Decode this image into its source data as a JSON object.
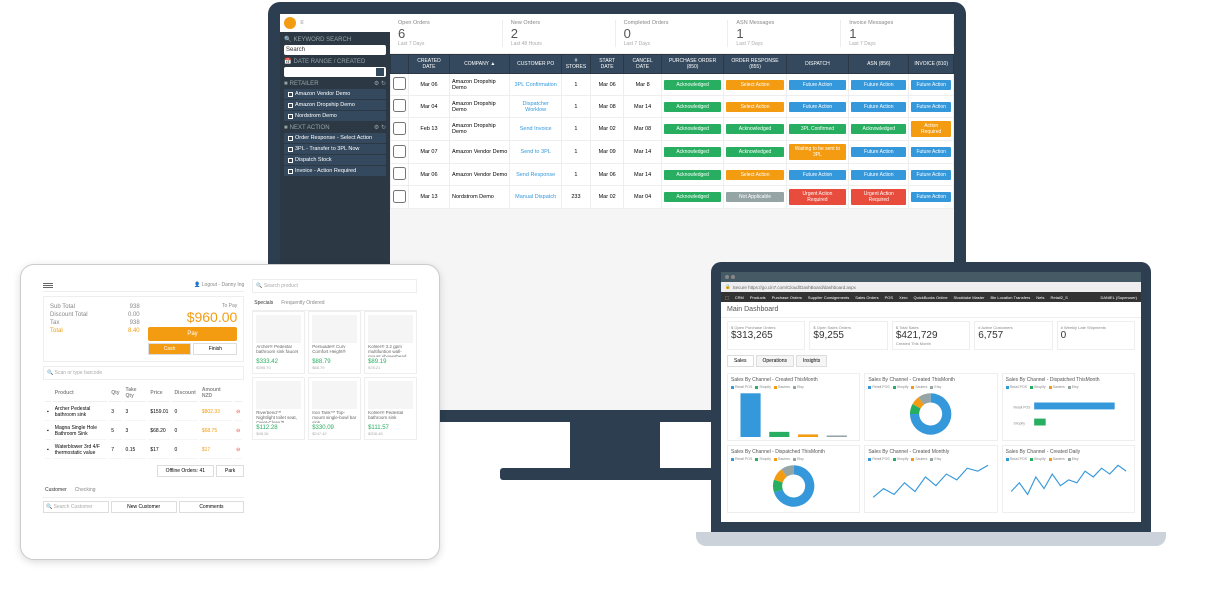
{
  "monitor": {
    "sidebar": {
      "keyword_search_label": "KEYWORD SEARCH",
      "search_placeholder": "Search",
      "date_range_label": "DATE RANGE / CREATED",
      "retailer_label": "RETAILER",
      "retailers": [
        "Amazon Vendor Demo",
        "Amazon Dropship Demo",
        "Nordstrom Demo"
      ],
      "next_action_label": "NEXT ACTION",
      "next_actions": [
        "Order Response - Select Action",
        "3PL - Transfer to 3PL Now",
        "Dispatch Stock",
        "Invoice - Action Required"
      ]
    },
    "stats": [
      {
        "label": "Open Orders",
        "value": "6",
        "sub": "Last 7 Days"
      },
      {
        "label": "New Orders",
        "value": "2",
        "sub": "Last 48 Hours"
      },
      {
        "label": "Completed Orders",
        "value": "0",
        "sub": "Last 7 Days"
      },
      {
        "label": "ASN Messages",
        "value": "1",
        "sub": "Last 7 Days"
      },
      {
        "label": "Invoice Messages",
        "value": "1",
        "sub": "Last 7 Days"
      }
    ],
    "table": {
      "headers": [
        "",
        "CREATED DATE",
        "COMPANY ▲",
        "CUSTOMER PO",
        "# STORES",
        "START DATE",
        "CANCEL DATE",
        "PURCHASE ORDER (850)",
        "ORDER RESPONSE (855)",
        "DISPATCH",
        "ASN (856)",
        "INVOICE (810)"
      ],
      "rows": [
        {
          "date": "Mar 06",
          "company": "Amazon Dropship Demo",
          "po": "3PL Confirmation",
          "stores": "1",
          "start": "Mar 06",
          "cancel": "Mar 8",
          "cells": [
            {
              "t": "Acknowledged",
              "c": "green"
            },
            {
              "t": "Select Action",
              "c": "orange"
            },
            {
              "t": "Future Action",
              "c": "blue"
            },
            {
              "t": "Future Action",
              "c": "blue"
            },
            {
              "t": "Future Action",
              "c": "blue"
            }
          ]
        },
        {
          "date": "Mar 04",
          "company": "Amazon Dropship Demo",
          "po": "Dispatcher Worklow",
          "stores": "1",
          "start": "Mar 08",
          "cancel": "Mar 14",
          "cells": [
            {
              "t": "Acknowledged",
              "c": "green"
            },
            {
              "t": "Select Action",
              "c": "orange"
            },
            {
              "t": "Future Action",
              "c": "blue"
            },
            {
              "t": "Future Action",
              "c": "blue"
            },
            {
              "t": "Future Action",
              "c": "blue"
            }
          ]
        },
        {
          "date": "Feb 13",
          "company": "Amazon Dropship Demo",
          "po": "Send Invoice",
          "stores": "1",
          "start": "Mar 02",
          "cancel": "Mar 08",
          "cells": [
            {
              "t": "Acknowledged",
              "c": "green"
            },
            {
              "t": "Acknowledged",
              "c": "green"
            },
            {
              "t": "3PL Confirmed",
              "c": "green"
            },
            {
              "t": "Acknowledged",
              "c": "green"
            },
            {
              "t": "Action Required",
              "c": "orange"
            }
          ]
        },
        {
          "date": "Mar 07",
          "company": "Amazon Vendor Demo",
          "po": "Send to 3PL",
          "stores": "1",
          "start": "Mar 09",
          "cancel": "Mar 14",
          "cells": [
            {
              "t": "Acknowledged",
              "c": "green"
            },
            {
              "t": "Acknowledged",
              "c": "green"
            },
            {
              "t": "Waiting to be sent to 3PL",
              "c": "orange"
            },
            {
              "t": "Future Action",
              "c": "blue"
            },
            {
              "t": "Future Action",
              "c": "blue"
            }
          ]
        },
        {
          "date": "Mar 06",
          "company": "Amazon Vendor Demo",
          "po": "Send Response",
          "stores": "1",
          "start": "Mar 06",
          "cancel": "Mar 14",
          "cells": [
            {
              "t": "Acknowledged",
              "c": "green"
            },
            {
              "t": "Select Action",
              "c": "orange"
            },
            {
              "t": "Future Action",
              "c": "blue"
            },
            {
              "t": "Future Action",
              "c": "blue"
            },
            {
              "t": "Future Action",
              "c": "blue"
            }
          ]
        },
        {
          "date": "Mar 13",
          "company": "Nordstrom Demo",
          "po": "Manual Dispatch",
          "stores": "233",
          "start": "Mar 02",
          "cancel": "Mar 04",
          "cells": [
            {
              "t": "Acknowledged",
              "c": "green"
            },
            {
              "t": "Not Applicable",
              "c": "gray"
            },
            {
              "t": "Urgent Action Required",
              "c": "red"
            },
            {
              "t": "Urgent Action Required",
              "c": "red"
            },
            {
              "t": "Future Action",
              "c": "blue"
            }
          ]
        }
      ]
    }
  },
  "tablet": {
    "user_label": "Logout - Danny Ing",
    "totals": {
      "subtotal_label": "Sub Total",
      "subtotal": "938",
      "discount_label": "Discount Total",
      "discount": "0.00",
      "tax_label": "Tax",
      "tax": "938",
      "total_label": "Total",
      "total": "8.40",
      "topay_label": "To Pay",
      "topay_amount": "$960.00"
    },
    "pay_label": "Pay",
    "cash_label": "Cash",
    "finish_label": "Finish",
    "scan_placeholder": "Scan or type barcode",
    "cart_headers": [
      "",
      "Product",
      "Qty",
      "Take Qty",
      "Price",
      "Discount",
      "Amount NZD",
      ""
    ],
    "cart_rows": [
      {
        "name": "Archer Pedestal bathroom sink",
        "qty": "3",
        "take": "3",
        "price": "$159.01",
        "disc": "0",
        "amt": "$802.33"
      },
      {
        "name": "Magna Single Hole Bathroom Sink",
        "qty": "5",
        "take": "3",
        "price": "$68.20",
        "disc": "0",
        "amt": "$68.75"
      },
      {
        "name": "Waterblower 3rd 4/F thermostatic value",
        "qty": "7",
        "take": "0.15",
        "price": "$17",
        "disc": "0",
        "amt": "$17"
      }
    ],
    "offline_label": "Offline Orders: 41",
    "park_label": "Park",
    "customer_tab": "Customer",
    "checking_tab": "Checking",
    "customer_placeholder": "Search Customer",
    "new_customer": "New Customer",
    "comments": "Comments",
    "specials_tab": "Specials",
    "freq_tab": "Frequently Ordered",
    "product_search": "Search product",
    "products": [
      {
        "name": "Archer® Pedestal bathroom sink faucet",
        "price": "$333.42",
        "old": "$395.70"
      },
      {
        "name": "Persuade® Curv Comfort Height®",
        "price": "$88.79",
        "old": "$88.79"
      },
      {
        "name": "Kohler® 3.2 gpm multifuntion wall-mount showerhead",
        "price": "$89.19",
        "old": "$78.21"
      },
      {
        "name": "Riverbend™ Nightlight toilet seat, Quiet-Close™",
        "price": "$112.28",
        "old": "$98.26"
      },
      {
        "name": "Iron Tank™ Top-mount single-bowl bar sink",
        "price": "$330.09",
        "old": "$247.42"
      },
      {
        "name": "Kohler® Pedestal bathroom sink",
        "price": "$111.57",
        "old": "$208.48"
      }
    ]
  },
  "laptop": {
    "url": "Secure https://go.cin7.com/Cloud/DashBoard/dashboard.aspx",
    "nav": [
      "CRM",
      "Products",
      "Purchase Orders",
      "Supplier Consignments",
      "Sales Orders",
      "POS",
      "Xero",
      "QuickBooks Online",
      "Stocktake Master",
      "Bin Location Transfers",
      "Nets",
      "Retail2_S"
    ],
    "user": "DANIEL (Superuser)",
    "title": "Main Dashboard",
    "metrics": [
      {
        "label": "$ Open Purchase Orders",
        "value": "$313,265"
      },
      {
        "label": "$ Open Sales Orders",
        "value": "$9,255"
      },
      {
        "label": "$ Total Sales",
        "value": "$421,729",
        "sub": "Created This Month"
      },
      {
        "label": "# Active Customers",
        "value": "6,757"
      },
      {
        "label": "# Weekly Late Shipments",
        "value": "0"
      }
    ],
    "tabs": [
      "Sales",
      "Operations",
      "Insights"
    ],
    "legend_items": [
      "Retail POS",
      "Shopify",
      "Sauters",
      "Etsy"
    ],
    "charts": [
      {
        "title": "Sales By Channel - Created ThisMonth",
        "type": "bar"
      },
      {
        "title": "Sales By Channel - Created ThisMonth",
        "type": "donut"
      },
      {
        "title": "Sales By Channel - Dispatched ThisMonth",
        "type": "bar-h"
      },
      {
        "title": "Sales By Channel - Dispatched ThisMonth",
        "type": "donut"
      },
      {
        "title": "Sales By Channel - Created Monthly",
        "type": "line"
      },
      {
        "title": "Sales By Channel - Created Daily",
        "type": "line"
      }
    ]
  },
  "chart_data": [
    {
      "type": "bar",
      "title": "Sales By Channel - Created ThisMonth",
      "categories": [
        "Retail POS",
        "Shopify",
        "Sauters",
        "Etsy"
      ],
      "values": [
        85,
        10,
        5,
        3
      ],
      "ylim": [
        0,
        100
      ]
    },
    {
      "type": "pie",
      "title": "Sales By Channel - Created ThisMonth",
      "series": [
        {
          "name": "Retail POS",
          "value": 75
        },
        {
          "name": "Shopify",
          "value": 8
        },
        {
          "name": "Sauters",
          "value": 7
        },
        {
          "name": "Etsy",
          "value": 10
        }
      ]
    },
    {
      "type": "bar",
      "title": "Sales By Channel - Dispatched ThisMonth",
      "categories": [
        "Retail POS",
        "Shopify"
      ],
      "values": [
        90,
        10
      ]
    },
    {
      "type": "pie",
      "title": "Sales By Channel - Dispatched ThisMonth",
      "series": [
        {
          "name": "Retail POS",
          "value": 70
        },
        {
          "name": "Shopify",
          "value": 10
        },
        {
          "name": "Sauters",
          "value": 10
        },
        {
          "name": "Etsy",
          "value": 10
        }
      ]
    },
    {
      "type": "line",
      "title": "Sales By Channel - Created Monthly",
      "x": [
        1,
        2,
        3,
        4,
        5,
        6,
        7,
        8,
        9,
        10,
        11,
        12
      ],
      "series": [
        {
          "name": "Retail POS",
          "values": [
            20,
            35,
            25,
            45,
            30,
            55,
            40,
            60,
            50,
            70,
            65,
            75
          ]
        }
      ]
    },
    {
      "type": "line",
      "title": "Sales By Channel - Created Daily",
      "x": [
        1,
        2,
        3,
        4,
        5,
        6,
        7,
        8,
        9,
        10,
        11,
        12,
        13,
        14,
        15
      ],
      "series": [
        {
          "name": "Retail POS",
          "values": [
            30,
            45,
            25,
            55,
            35,
            60,
            40,
            50,
            45,
            65,
            55,
            70,
            60,
            75,
            65
          ]
        }
      ]
    }
  ]
}
